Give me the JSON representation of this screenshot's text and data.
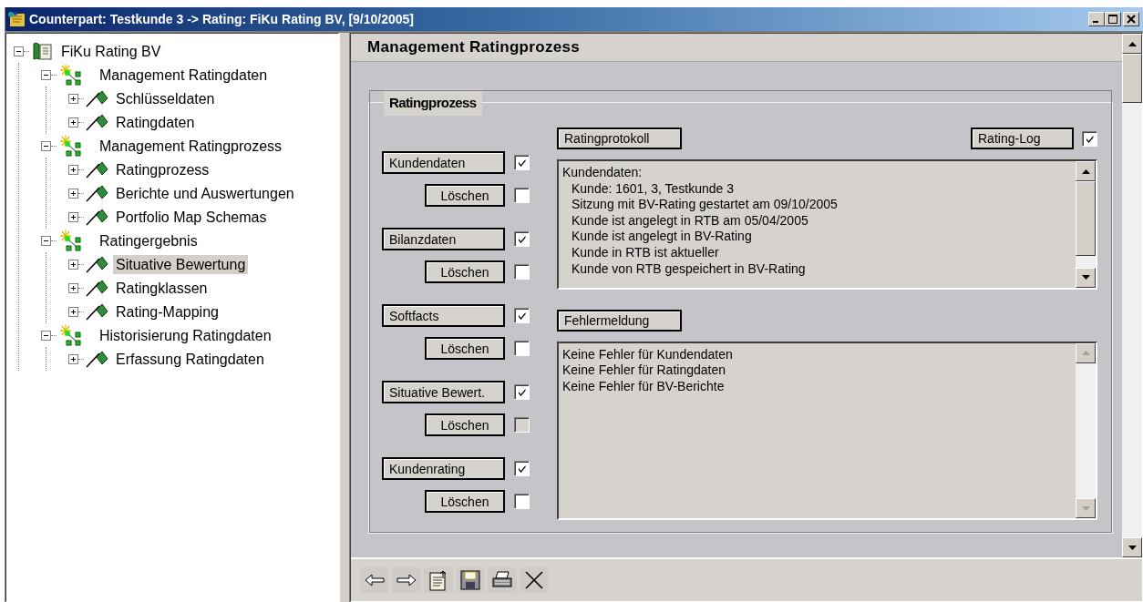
{
  "window": {
    "title": "Counterpart: Testkunde 3 -> Rating: FiKu Rating BV, [9/10/2005]"
  },
  "tree": [
    {
      "label": "FiKu Rating BV",
      "kind": "root",
      "expanded": true,
      "selected": false,
      "children": [
        {
          "label": "Management Ratingdaten",
          "kind": "folder",
          "expanded": true,
          "selected": false,
          "children": [
            {
              "label": "Schlüsseldaten",
              "kind": "leaf",
              "expanded": false,
              "selected": false
            },
            {
              "label": "Ratingdaten",
              "kind": "leaf",
              "expanded": false,
              "selected": false
            }
          ]
        },
        {
          "label": "Management Ratingprozess",
          "kind": "folder",
          "expanded": true,
          "selected": false,
          "children": [
            {
              "label": "Ratingprozess",
              "kind": "leaf",
              "expanded": false,
              "selected": false
            },
            {
              "label": "Berichte und Auswertungen",
              "kind": "leaf",
              "expanded": false,
              "selected": false
            },
            {
              "label": "Portfolio Map Schemas",
              "kind": "leaf",
              "expanded": false,
              "selected": false
            }
          ]
        },
        {
          "label": "Ratingergebnis",
          "kind": "folder",
          "expanded": true,
          "selected": false,
          "children": [
            {
              "label": "Situative Bewertung",
              "kind": "leaf",
              "expanded": false,
              "selected": true
            },
            {
              "label": "Ratingklassen",
              "kind": "leaf",
              "expanded": false,
              "selected": false
            },
            {
              "label": "Rating-Mapping",
              "kind": "leaf",
              "expanded": false,
              "selected": false
            }
          ]
        },
        {
          "label": "Historisierung Ratingdaten",
          "kind": "folder",
          "expanded": true,
          "selected": false,
          "children": [
            {
              "label": "Erfassung Ratingdaten",
              "kind": "leaf",
              "expanded": false,
              "selected": false
            }
          ]
        }
      ]
    }
  ],
  "panel": {
    "title": "Management Ratingprozess"
  },
  "form": {
    "title": "Ratingprozess",
    "items": [
      {
        "label": "Kundendaten",
        "checked": true,
        "delete": {
          "label": "Löschen",
          "checked": false,
          "disabled": false
        }
      },
      {
        "label": "Bilanzdaten",
        "checked": true,
        "delete": {
          "label": "Löschen",
          "checked": false,
          "disabled": false
        }
      },
      {
        "label": "Softfacts",
        "checked": true,
        "delete": {
          "label": "Löschen",
          "checked": false,
          "disabled": false
        }
      },
      {
        "label": "Situative Bewert.",
        "checked": true,
        "delete": {
          "label": "Löschen",
          "checked": false,
          "disabled": true
        }
      },
      {
        "label": "Kundenrating",
        "checked": true,
        "delete": {
          "label": "Löschen",
          "checked": false,
          "disabled": false
        }
      }
    ],
    "protocol": {
      "label": "Ratingprotokoll",
      "lines": [
        {
          "text": "Kundendaten:",
          "indented": false
        },
        {
          "text": "Kunde: 1601, 3, Testkunde 3",
          "indented": true
        },
        {
          "text": "Sitzung mit BV-Rating gestartet am 09/10/2005",
          "indented": true
        },
        {
          "text": "Kunde ist angelegt in RTB am 05/04/2005",
          "indented": true
        },
        {
          "text": "Kunde ist angelegt in BV-Rating",
          "indented": true
        },
        {
          "text": "Kunde in RTB ist aktueller",
          "indented": true
        },
        {
          "text": "Kunde von RTB gespeichert in BV-Rating",
          "indented": true
        }
      ]
    },
    "rating_log": {
      "label": "Rating-Log",
      "checked": true
    },
    "errors": {
      "label": "Fehlermeldung",
      "lines": [
        {
          "text": "Keine Fehler für Kundendaten",
          "indented": false
        },
        {
          "text": "Keine Fehler für Ratingdaten",
          "indented": false
        },
        {
          "text": "Keine Fehler für BV-Berichte",
          "indented": false
        }
      ]
    }
  }
}
